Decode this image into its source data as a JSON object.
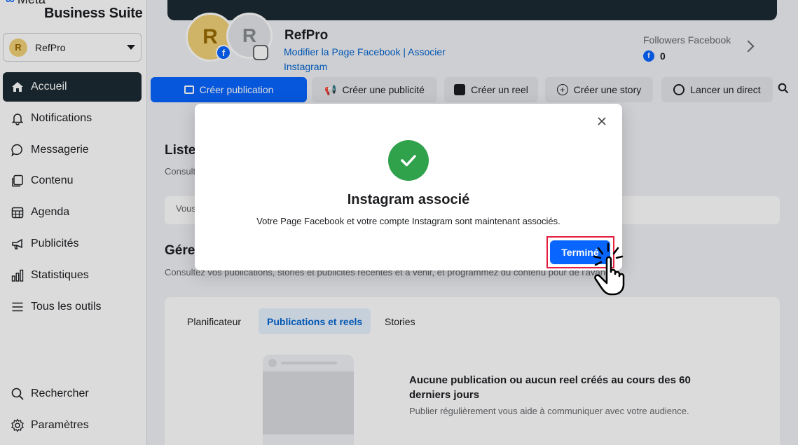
{
  "brand": {
    "top": "Meta",
    "bottom": "Business Suite"
  },
  "account": {
    "initial": "R",
    "name": "RefPro"
  },
  "nav": [
    {
      "label": "Accueil",
      "icon": "home-icon",
      "active": true
    },
    {
      "label": "Notifications",
      "icon": "bell-icon"
    },
    {
      "label": "Messagerie",
      "icon": "chat-icon"
    },
    {
      "label": "Contenu",
      "icon": "content-icon"
    },
    {
      "label": "Agenda",
      "icon": "calendar-icon"
    },
    {
      "label": "Publicités",
      "icon": "megaphone-icon"
    },
    {
      "label": "Statistiques",
      "icon": "chart-icon"
    },
    {
      "label": "Tous les outils",
      "icon": "menu-icon"
    }
  ],
  "nav_bottom": [
    {
      "label": "Rechercher",
      "icon": "search-icon"
    },
    {
      "label": "Paramètres",
      "icon": "gear-icon"
    }
  ],
  "profile": {
    "initial_fb": "R",
    "initial_ig": "R",
    "name": "RefPro",
    "links": "Modifier la Page Facebook | Associer Instagram",
    "followers_label": "Followers Facebook",
    "followers_count": "0"
  },
  "actions": {
    "create_post": "Créer publication",
    "create_ad": "Créer une publicité",
    "create_reel": "Créer un reel",
    "create_story": "Créer une story",
    "go_live": "Lancer un direct"
  },
  "main": {
    "section1_title": "Liste",
    "section1_sub": "Consult",
    "section1_box": "Vous",
    "section2_title": "Gére",
    "section2_sub": "Consultez vos publications, stories et publicités récentes et à venir, et programmez du contenu pour          de l'avance.",
    "tabs": [
      "Planificateur",
      "Publications et reels",
      "Stories"
    ],
    "empty_title": "Aucune publication ou aucun reel créés au cours des 60 derniers jours",
    "empty_sub": "Publier régulièrement vous aide à communiquer avec votre audience."
  },
  "modal": {
    "title": "Instagram associé",
    "text": "Votre Page Facebook et votre compte Instagram sont maintenant associés.",
    "done": "Terminé"
  },
  "colors": {
    "accent": "#0866ff",
    "success": "#31a24c",
    "highlight": "#e41e3f",
    "sidebar_active": "#1c2b33"
  }
}
